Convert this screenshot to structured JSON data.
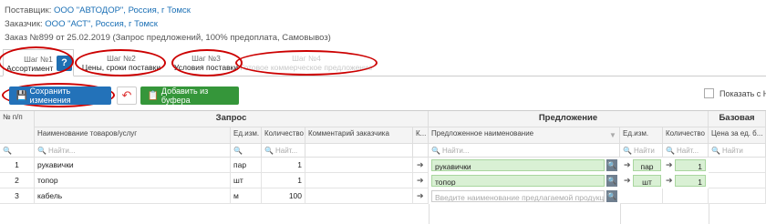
{
  "info": {
    "supplier_label": "Поставщик:",
    "supplier_value": "ООО \"АВТОДОР\", Россия, г Томск",
    "customer_label": "Заказчик:",
    "customer_value": "ООО \"АСТ\", Россия, г Томск",
    "order": "Заказ №899 от 25.02.2019 (Запрос предложений, 100% предоплата, Самовывоз)"
  },
  "tabs": [
    {
      "step": "Шаг №1",
      "title": "Ассортимент"
    },
    {
      "step": "Шаг №2",
      "title": "Цены, сроки поставки"
    },
    {
      "step": "Шаг №3",
      "title": "Условия поставки"
    },
    {
      "step": "Шаг №4",
      "title": "Готовое коммерческое предложение"
    }
  ],
  "help_label": "?",
  "toolbar": {
    "save_label": "Сохранить изменения",
    "paste_label": "Добавить из буфера",
    "show_label": "Показать с НДС"
  },
  "table": {
    "groups": {
      "request": "Запрос",
      "offer": "Предложение",
      "base": "Базовая"
    },
    "headers": {
      "num": "№ п/п",
      "name": "Наименование товаров/услуг",
      "unit": "Ед.изм.",
      "qty": "Количество",
      "comment": "Комментарий заказчика",
      "k": "К...",
      "offer_name": "Предложенное наименование",
      "offer_unit": "Ед.изм.",
      "offer_qty": "Количество",
      "price": "Цена за ед. б..."
    },
    "filter_placeholder": "Найти...",
    "filter_short": "Найт...",
    "filter_tiny": "Найти",
    "rows": [
      {
        "num": "1",
        "name": "рукавички",
        "unit": "пар",
        "qty": "1",
        "offer_name": "рукавички",
        "offer_unit": "пар",
        "offer_qty": "1"
      },
      {
        "num": "2",
        "name": "топор",
        "unit": "шт",
        "qty": "1",
        "offer_name": "топор",
        "offer_unit": "шт",
        "offer_qty": "1"
      },
      {
        "num": "3",
        "name": "кабель",
        "unit": "м",
        "qty": "100",
        "offer_placeholder": "Введите наименование предлагаемой продукции"
      }
    ]
  }
}
